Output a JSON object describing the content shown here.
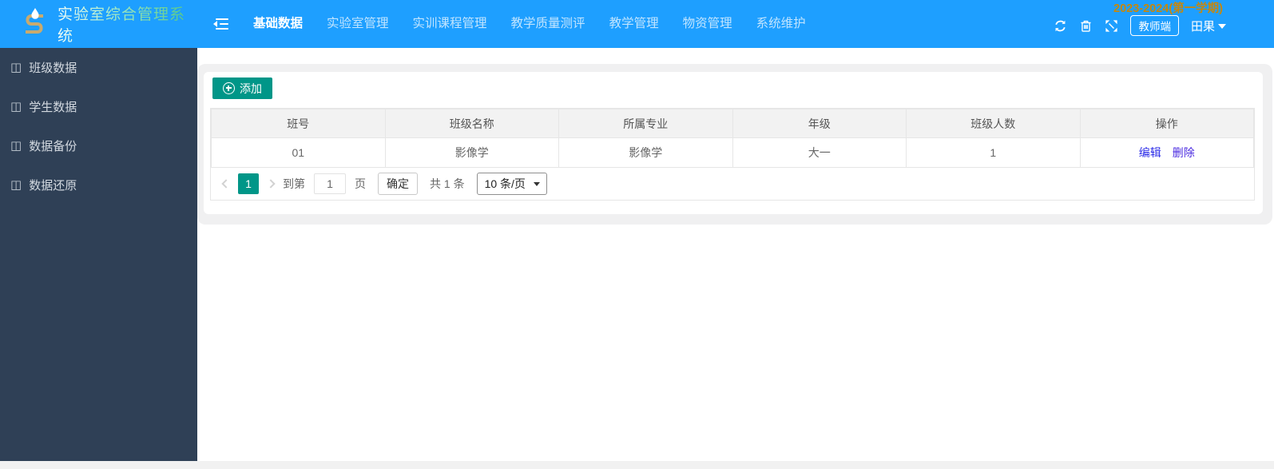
{
  "header": {
    "app_title": "实验室综合管理系统",
    "semester_label": "2023-2024(第一学期)",
    "nav_items": [
      {
        "label": "基础数据",
        "active": true
      },
      {
        "label": "实验室管理",
        "active": false
      },
      {
        "label": "实训课程管理",
        "active": false
      },
      {
        "label": "教学质量测评",
        "active": false
      },
      {
        "label": "教学管理",
        "active": false
      },
      {
        "label": "物资管理",
        "active": false
      },
      {
        "label": "系统维护",
        "active": false
      }
    ],
    "icons": [
      "refresh-icon",
      "trash-icon",
      "fullscreen-icon"
    ],
    "role_badge": "教师端",
    "username": "田果"
  },
  "sidebar": {
    "icon_glyph": "◫",
    "items": [
      {
        "label": "班级数据"
      },
      {
        "label": "学生数据"
      },
      {
        "label": "数据备份"
      },
      {
        "label": "数据还原"
      }
    ]
  },
  "toolbar": {
    "add_label": "添加"
  },
  "table": {
    "columns": [
      "班号",
      "班级名称",
      "所属专业",
      "年级",
      "班级人数",
      "操作"
    ],
    "rows": [
      {
        "cells": [
          "01",
          "影像学",
          "影像学",
          "大一",
          "1"
        ],
        "actions": [
          "编辑",
          "删除"
        ]
      }
    ]
  },
  "pagination": {
    "current_page": "1",
    "goto_prefix": "到第",
    "goto_value": "1",
    "goto_suffix": "页",
    "confirm_label": "确定",
    "total_label": "共 1 条",
    "page_size": "10 条/页"
  },
  "colors": {
    "header_blue": "#1E9FFF",
    "sidebar_dark": "#2F4056",
    "accent_teal": "#009688",
    "semester_gold": "#C5870E",
    "link_edit": "#2B2BE8",
    "link_delete": "#4A2AE0",
    "panel_gray": "#f0f0f1"
  }
}
